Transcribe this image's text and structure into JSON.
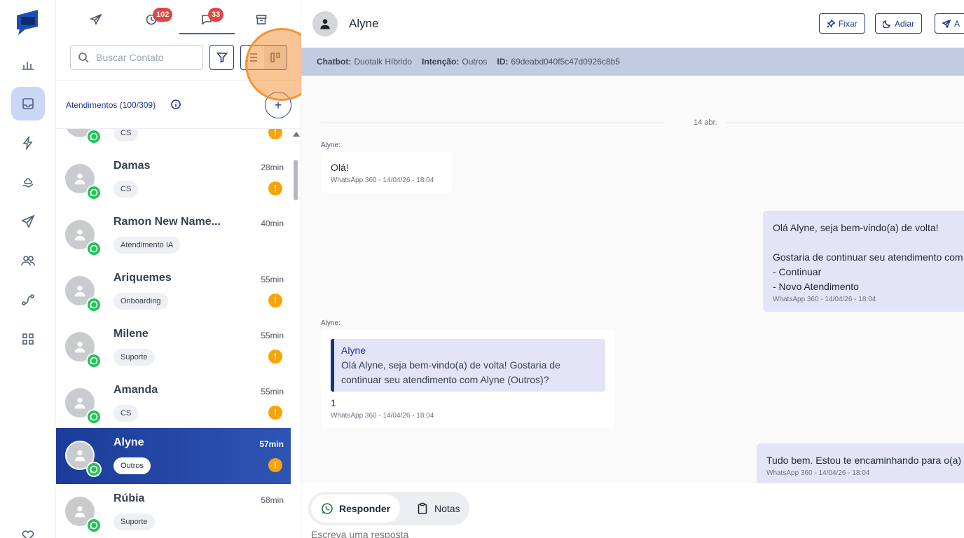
{
  "tabs": {
    "history_badge": "102",
    "chats_badge": "33"
  },
  "search": {
    "placeholder": "Buscar Contato"
  },
  "list_header": {
    "title": "Atendimentos (100/309)"
  },
  "conversations": [
    {
      "name": "",
      "time": "",
      "tag": "CS",
      "warning": true,
      "selected": false
    },
    {
      "name": "Damas",
      "time": "28min",
      "tag": "CS",
      "warning": true,
      "selected": false
    },
    {
      "name": "Ramon New Name...",
      "time": "40min",
      "tag": "Atendimento IA",
      "warning": false,
      "selected": false
    },
    {
      "name": "Ariquemes",
      "time": "55min",
      "tag": "Onboarding",
      "warning": true,
      "selected": false
    },
    {
      "name": "Milene",
      "time": "55min",
      "tag": "Suporte",
      "warning": true,
      "selected": false
    },
    {
      "name": "Amanda",
      "time": "55min",
      "tag": "CS",
      "warning": true,
      "selected": false
    },
    {
      "name": "Alyne",
      "time": "57min",
      "tag": "Outros",
      "warning": true,
      "selected": true
    },
    {
      "name": "Rúbia",
      "time": "58min",
      "tag": "Suporte",
      "warning": false,
      "selected": false
    }
  ],
  "chat": {
    "contact_name": "Alyne",
    "buttons": {
      "pin": "Fixar",
      "postpone": "Adiar",
      "send": "A"
    },
    "info": {
      "chatbot_label": "Chatbot:",
      "chatbot_value": "Duotalk Híbrido",
      "intent_label": "Intenção:",
      "intent_value": "Outros",
      "id_label": "ID:",
      "id_value": "69deabd040f5c47d0926c8b5"
    },
    "date_divider": "14 abr.",
    "messages": [
      {
        "sender": "Alyne:",
        "text": "Olá!",
        "meta": "WhatsApp 360 - 14/04/26 - 18:04"
      },
      {
        "text": "Olá Alyne, seja bem-vindo(a) de volta!\n\nGostaria de continuar seu atendimento com\n- Continuar\n- Novo Atendimento",
        "meta": "WhatsApp 360 - 14/04/26 - 18:04"
      },
      {
        "sender": "Alyne:",
        "quote_name": "Alyne",
        "quote_text": "Olá Alyne, seja bem-vindo(a) de volta! Gostaria de continuar seu atendimento com Alyne (Outros)?",
        "text": "1",
        "meta": "WhatsApp 360 - 14/04/26 - 18:04"
      },
      {
        "text": "Tudo bem. Estou te encaminhando para o(a)",
        "meta": "WhatsApp 360 - 14/04/26 - 18:04"
      }
    ]
  },
  "composer": {
    "reply_tab": "Responder",
    "notes_tab": "Notas",
    "placeholder": "Escreva uma resposta"
  },
  "colors": {
    "brand": "#1e3a8a",
    "whatsapp": "#25c35c",
    "warning": "#f5a40a",
    "badge": "#e04646"
  }
}
